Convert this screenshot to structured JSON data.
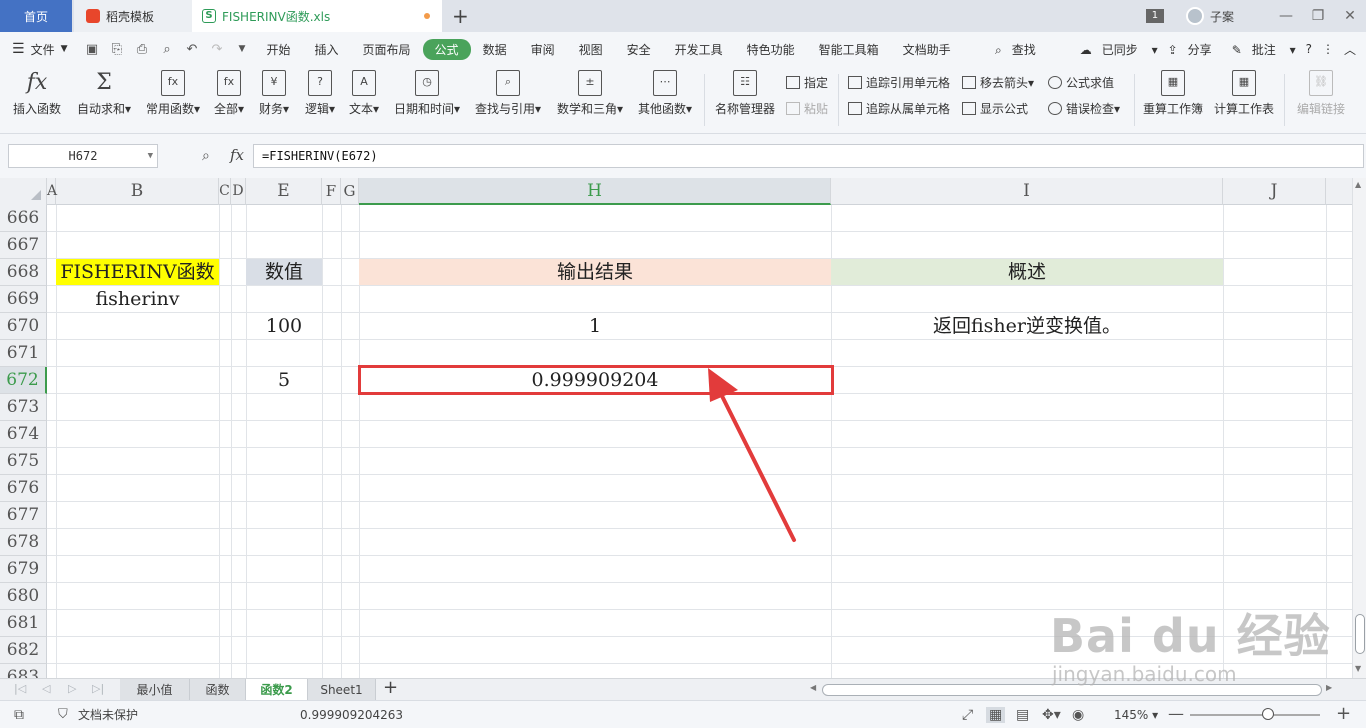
{
  "tabs": {
    "home": "首页",
    "docer": "稻壳模板",
    "file": "FISHERINV函数.xls",
    "badge": "1",
    "user": "子案"
  },
  "menu": {
    "file": "文件",
    "items": [
      "开始",
      "插入",
      "页面布局",
      "公式",
      "数据",
      "审阅",
      "视图",
      "安全",
      "开发工具",
      "特色功能",
      "智能工具箱",
      "文档助手"
    ],
    "active": "公式",
    "search": "查找",
    "synced": "已同步",
    "share": "分享",
    "comment": "批注"
  },
  "ribbon": {
    "insert_function": "插入函数",
    "autosum": "自动求和",
    "common": "常用函数",
    "all": "全部",
    "finance": "财务",
    "logic": "逻辑",
    "text": "文本",
    "datetime": "日期和时间",
    "lookup": "查找与引用",
    "math": "数学和三角",
    "other": "其他函数",
    "name_manager": "名称管理器",
    "define": "指定",
    "paste": "粘贴",
    "trace_precedents": "追踪引用单元格",
    "trace_dependents": "追踪从属单元格",
    "remove_arrows": "移去箭头",
    "show_formulas": "显示公式",
    "evaluate": "公式求值",
    "error_check": "错误检查",
    "recalc_workbook": "重算工作簿",
    "calc_sheet": "计算工作表",
    "edit_links": "编辑链接"
  },
  "formula_bar": {
    "name_box": "H672",
    "fx": "fx",
    "formula": "=FISHERINV(E672)"
  },
  "grid": {
    "columns": [
      "A",
      "B",
      "C",
      "D",
      "E",
      "F",
      "G",
      "H",
      "I",
      "J"
    ],
    "selected_column": "H",
    "rows": [
      "666",
      "667",
      "668",
      "669",
      "670",
      "671",
      "672",
      "673",
      "674",
      "675",
      "676",
      "677",
      "678",
      "679",
      "680",
      "681",
      "682",
      "683"
    ],
    "selected_row": "672",
    "b668": "FISHERINV函数",
    "e668": "数值",
    "h668": "输出结果",
    "i668": "概述",
    "b669": "fisherinv",
    "e670": "100",
    "h670": "1",
    "i670": "返回fisher逆变换值。",
    "e672": "5",
    "h672": "0.999909204",
    "colors": {
      "yellow_header": "#ffff00",
      "gray_header": "#d9dee6",
      "peach_header": "#fbe3d7",
      "green_header": "#e1ecd9",
      "selection": "#e23b3b",
      "accent": "#3c9b4c"
    }
  },
  "sheets": {
    "tabs": [
      "最小值",
      "函数",
      "函数2",
      "Sheet1"
    ],
    "active": "函数2"
  },
  "status": {
    "protection": "文档未保护",
    "value": "0.999909204263",
    "zoom": "145%"
  },
  "watermark": {
    "main": "Bai du 经验",
    "sub": "jingyan.baidu.com"
  }
}
